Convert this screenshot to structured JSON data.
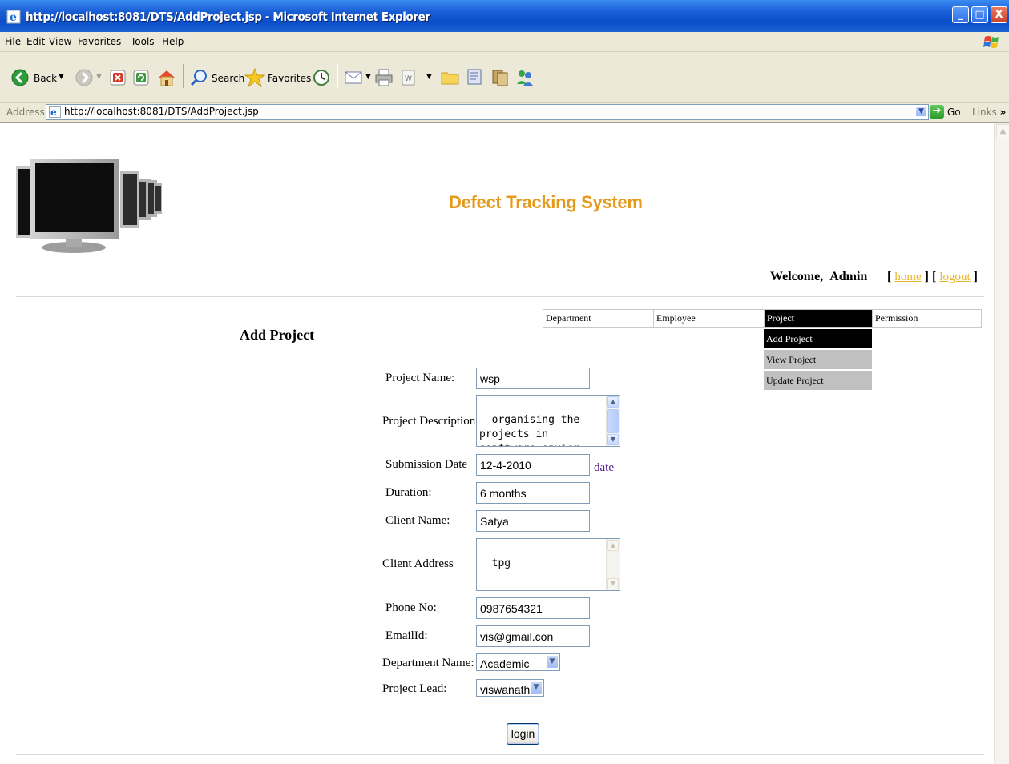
{
  "window": {
    "title": "http://localhost:8081/DTS/AddProject.jsp - Microsoft Internet Explorer",
    "minimize": "_",
    "maximize": "□",
    "close": "X"
  },
  "menubar": {
    "items": [
      "File",
      "Edit",
      "View",
      "Favorites",
      "Tools",
      "Help"
    ]
  },
  "toolbar": {
    "back_label": "Back",
    "search_label": "Search",
    "favorites_label": "Favorites"
  },
  "address_bar": {
    "label": "Address",
    "url": "http://localhost:8081/DTS/AddProject.jsp",
    "go_label": "Go",
    "links_label": "Links",
    "links_chevron": "»"
  },
  "header": {
    "app_title": "Defect Tracking System",
    "welcome_label": "Welcome,",
    "user_name": "Admin",
    "home_link": "home",
    "logout_link": "logout",
    "bracket_open": "[",
    "bracket_close": "]"
  },
  "nav_menu": {
    "items": [
      "Department",
      "Employee",
      "Project",
      "Permission"
    ],
    "active": "Project",
    "submenu": [
      "Add Project",
      "View Project",
      "Update Project"
    ],
    "submenu_active": "Add Project"
  },
  "form": {
    "heading": "Add Project",
    "project_name_label": "Project Name:",
    "project_name_value": "wsp",
    "project_description_label": "Project Description",
    "project_description_value": "organising the\nprojects in\nsopftware envier",
    "submission_date_label": "Submission Date",
    "submission_date_value": "12-4-2010",
    "date_link": "date",
    "duration_label": "Duration:",
    "duration_value": "6 months",
    "client_name_label": "Client Name:",
    "client_name_value": "Satya",
    "client_address_label": "Client Address",
    "client_address_value": "tpg",
    "phone_label": "Phone No:",
    "phone_value": "0987654321",
    "email_label": "EmailId:",
    "email_value": "vis@gmail.con",
    "department_label": "Department Name:",
    "department_value": "Academic",
    "project_lead_label": "Project Lead:",
    "project_lead_value": "viswanath",
    "submit_label": "login"
  },
  "colors": {
    "app_title": "#e49a1c",
    "link": "#e9b42a",
    "titlebar": "#0a4fc8",
    "menu_active_bg": "#000000",
    "submenu_bg": "#c0c0c0"
  }
}
